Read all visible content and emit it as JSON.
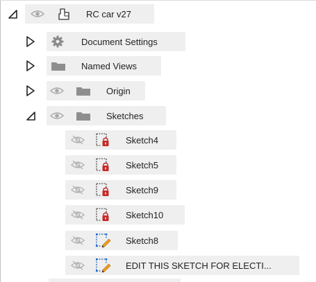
{
  "root": {
    "label": "RC car v27"
  },
  "folders": [
    {
      "label": "Document Settings",
      "expanded": false,
      "eye": false,
      "icon": "gear-icon"
    },
    {
      "label": "Named Views",
      "expanded": false,
      "eye": false,
      "icon": "folder-icon"
    },
    {
      "label": "Origin",
      "expanded": false,
      "eye": true,
      "icon": "folder-icon"
    },
    {
      "label": "Sketches",
      "expanded": true,
      "eye": true,
      "icon": "folder-icon"
    }
  ],
  "sketches": [
    {
      "label": "Sketch4",
      "state": "locked"
    },
    {
      "label": "Sketch5",
      "state": "locked"
    },
    {
      "label": "Sketch9",
      "state": "locked"
    },
    {
      "label": "Sketch10",
      "state": "locked"
    },
    {
      "label": "Sketch8",
      "state": "editable"
    },
    {
      "label": "EDIT THIS SKETCH FOR ELECTI...",
      "state": "editable"
    }
  ],
  "colors": {
    "row_bg": "#efefef",
    "lock_red": "#c62828",
    "pencil_orange": "#f0a020",
    "sketch_blue": "#1f62c9"
  }
}
